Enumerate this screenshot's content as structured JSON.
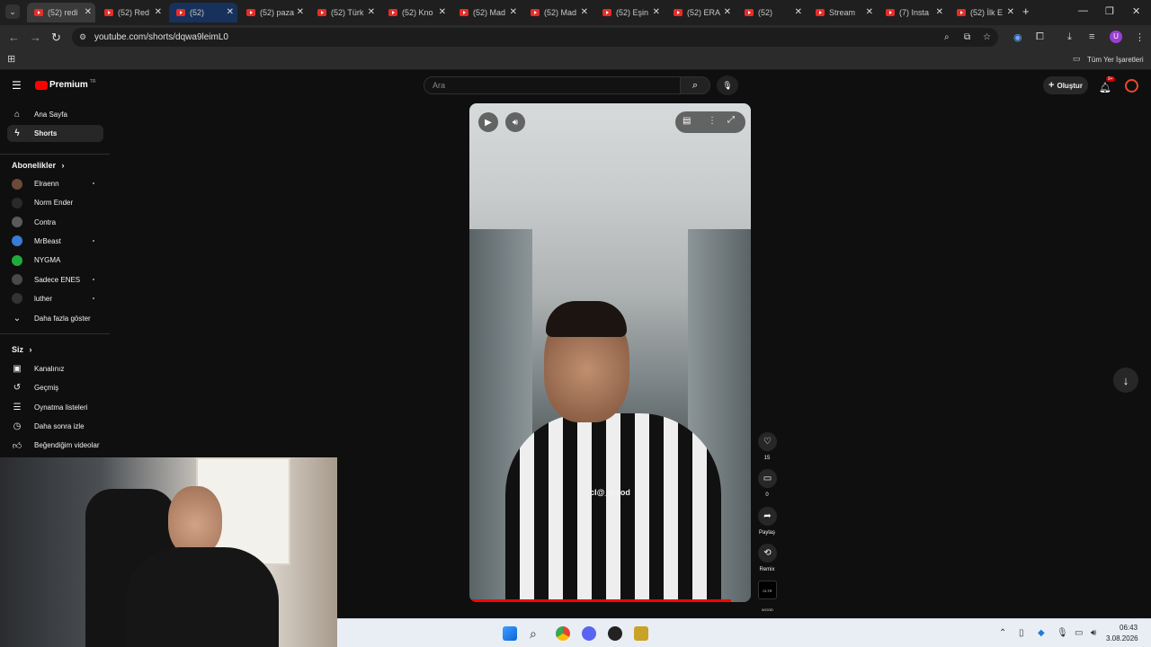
{
  "browser": {
    "tabs": [
      {
        "title": "(52) redi"
      },
      {
        "title": "(52) Red"
      },
      {
        "title": "(52)"
      },
      {
        "title": "(52) paza"
      },
      {
        "title": "(52) Türk"
      },
      {
        "title": "(52) Kno"
      },
      {
        "title": "(52) Mad"
      },
      {
        "title": "(52) Mad"
      },
      {
        "title": "(52) Eşin"
      },
      {
        "title": "(52) ERA"
      },
      {
        "title": "(52)"
      },
      {
        "title": "Stream"
      },
      {
        "title": "(7) Insta"
      },
      {
        "title": "(52) İlk E"
      }
    ],
    "url": "youtube.com/shorts/dqwa9leimL0",
    "bookmarks_label": "Tüm Yer İşaretleri",
    "profile_initial": "U"
  },
  "youtube": {
    "logo_text": "Premium",
    "logo_country": "TR",
    "search_placeholder": "Ara",
    "create_label": "Oluştur",
    "notif_count": "9+",
    "nav": [
      {
        "label": "Ana Sayfa",
        "icon": "home-icon"
      },
      {
        "label": "Shorts",
        "icon": "shorts-icon"
      }
    ],
    "subscriptions_title": "Abonelikler",
    "subscriptions": [
      {
        "label": "Elraenn",
        "color": "#6b4a3a",
        "live": true
      },
      {
        "label": "Norm Ender",
        "color": "#2a2a2a",
        "live": false
      },
      {
        "label": "Contra",
        "color": "#5a5a5a",
        "live": false
      },
      {
        "label": "MrBeast",
        "color": "#3a7bd5",
        "live": true
      },
      {
        "label": "NYGMA",
        "color": "#1faa3a",
        "live": false
      },
      {
        "label": "Sadece ENES",
        "color": "#4a4a4a",
        "live": true
      },
      {
        "label": "luther",
        "color": "#333333",
        "live": true
      }
    ],
    "show_more": "Daha fazla göster",
    "you_title": "Siz",
    "you_items": [
      {
        "label": "Kanalınız",
        "icon": "channel-icon"
      },
      {
        "label": "Geçmiş",
        "icon": "history-icon"
      },
      {
        "label": "Oynatma listeleri",
        "icon": "playlist-icon"
      },
      {
        "label": "Daha sonra izle",
        "icon": "clock-icon"
      },
      {
        "label": "Beğendiğim videolar",
        "icon": "like-icon"
      }
    ],
    "short": {
      "creator_tag": "cl@_wood",
      "likes": "15",
      "comments": "0",
      "share_label": "Paylaş",
      "remix_label": "Remix",
      "channel_badge": "CLTR WOOD",
      "progress": 0.93
    }
  },
  "taskbar": {
    "time": "06:43",
    "date": "3.08.2026"
  }
}
